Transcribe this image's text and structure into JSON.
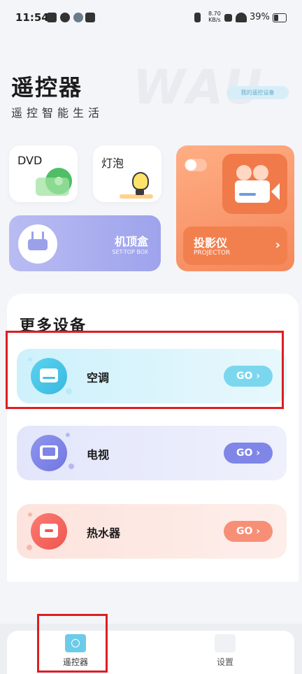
{
  "status_bar": {
    "time": "11:54",
    "net_speed_value": "8.70",
    "net_speed_unit": "KB/s",
    "battery": "39%"
  },
  "header": {
    "title": "遥控器",
    "subtitle": "遥控智能生活",
    "watermark": "WAU",
    "my_devices_button": "我的遥控设备"
  },
  "cards": {
    "dvd": {
      "label": "DVD",
      "icon": "disc-icon"
    },
    "bulb": {
      "label": "灯泡",
      "icon": "lightbulb-icon"
    },
    "settop": {
      "label": "机顶盒",
      "sublabel": "SET-TOP BOX",
      "icon": "settop-box-icon"
    },
    "projector": {
      "label": "投影仪",
      "sublabel": "PROJECTOR",
      "arrow": "›",
      "icon": "video-camera-icon"
    }
  },
  "more_devices": {
    "title": "更多设备",
    "items": [
      {
        "label": "空调",
        "go": "GO ›",
        "icon": "air-conditioner-icon",
        "color": "#7ad7ee"
      },
      {
        "label": "电视",
        "go": "GO ›",
        "icon": "tv-icon",
        "color": "#7f86e8"
      },
      {
        "label": "热水器",
        "go": "GO ›",
        "icon": "water-heater-icon",
        "color": "#f78f77"
      }
    ]
  },
  "bottom_nav": {
    "tabs": [
      {
        "label": "遥控器",
        "icon": "power-icon",
        "active": true
      },
      {
        "label": "设置",
        "icon": "settings-icon",
        "active": false
      }
    ]
  }
}
